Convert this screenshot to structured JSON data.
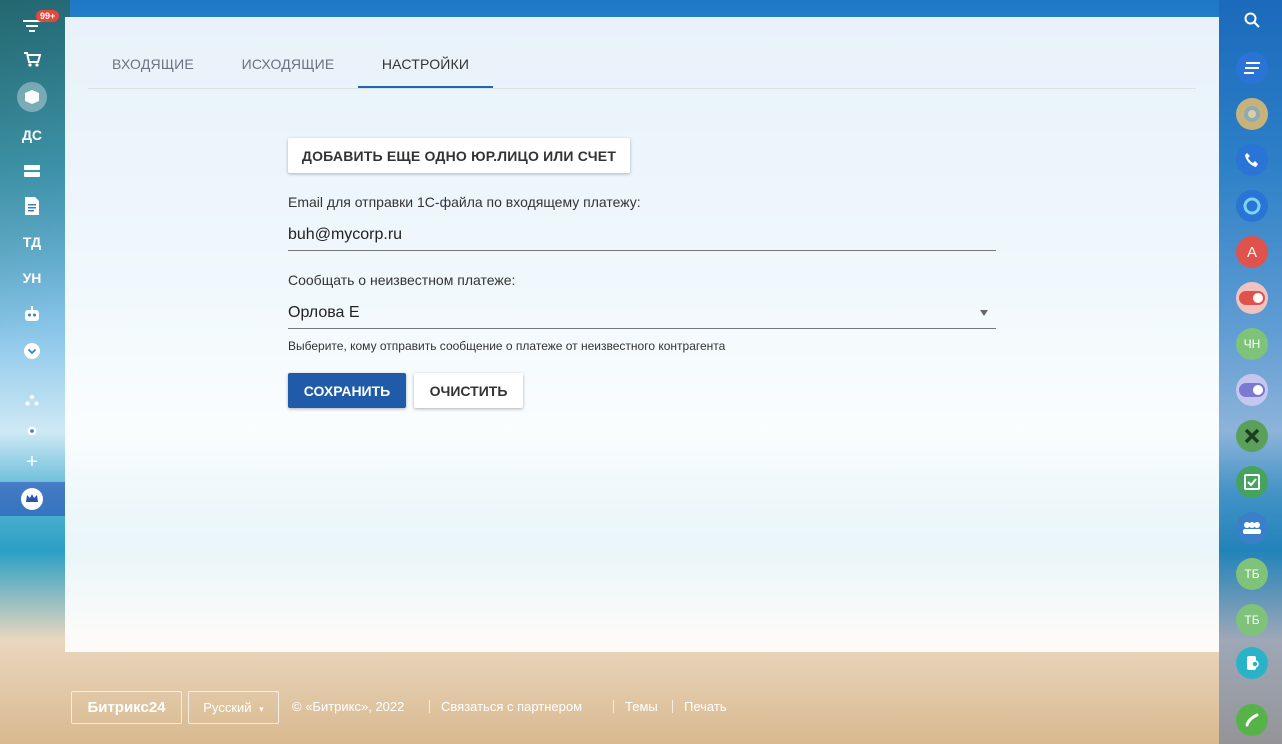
{
  "tabs": [
    {
      "label": "ВХОДЯЩИЕ"
    },
    {
      "label": "ИСХОДЯЩИЕ"
    },
    {
      "label": "НАСТРОЙКИ"
    }
  ],
  "form": {
    "add_button": "ДОБАВИТЬ ЕЩЕ ОДНО ЮР.ЛИЦО ИЛИ СЧЕТ",
    "email_label": "Email для отправки 1С-файла по входящему платежу:",
    "email_value": "buh@mycorp.ru",
    "notify_label": "Сообщать о неизвестном платеже:",
    "notify_value": "Орлова Е",
    "notify_hint": "Выберите, кому отправить сообщение о платеже от неизвестного контрагента",
    "save_button": "СОХРАНИТЬ",
    "clear_button": "ОЧИСТИТЬ"
  },
  "left_rail": {
    "badge": "99+",
    "items": [
      {
        "icon": "filter-icon"
      },
      {
        "icon": "cart-icon"
      },
      {
        "icon": "box-icon"
      },
      {
        "label": "ДС"
      },
      {
        "icon": "inbox-icon"
      },
      {
        "icon": "document-icon"
      },
      {
        "label": "ТД"
      },
      {
        "label": "УН"
      },
      {
        "icon": "robot-icon"
      },
      {
        "icon": "chevron-down-icon"
      },
      {
        "icon": "sitemap-icon"
      },
      {
        "icon": "gear-icon"
      },
      {
        "icon": "plus-icon"
      },
      {
        "icon": "crown-icon"
      }
    ]
  },
  "right_rail": {
    "items": [
      {
        "icon": "search-icon"
      },
      {
        "icon": "feed-icon",
        "color": "#2a74d6"
      },
      {
        "icon": "avatar-icon",
        "color": "#c7b27a"
      },
      {
        "icon": "phone-icon",
        "color": "#2a74d6"
      },
      {
        "icon": "circle-icon",
        "color": "#2a74d6"
      },
      {
        "icon": "letter-a-icon",
        "label": "А",
        "color": "#e0524c"
      },
      {
        "icon": "toggle-icon",
        "color": "#e0524c"
      },
      {
        "label": "ЧН",
        "color": "#7fc27a"
      },
      {
        "icon": "toggle-icon",
        "color": "#7a7bd0"
      },
      {
        "icon": "close-x-icon",
        "color": "#5aa05a"
      },
      {
        "icon": "checkbox-icon",
        "color": "#45a35e"
      },
      {
        "icon": "group-icon",
        "color": "#3a7fc8"
      },
      {
        "label": "ТБ",
        "color": "#7fc27a"
      },
      {
        "label": "ТБ",
        "color": "#7fc27a"
      },
      {
        "icon": "mobile-icon",
        "color": "#2ab3c8"
      },
      {
        "icon": "call-icon",
        "color": "#55b34a"
      }
    ]
  },
  "footer": {
    "logo": "Битрикс24",
    "language": "Русский",
    "copyright": "© «Битрикс», 2022",
    "partner_link": "Связаться с партнером",
    "themes_link": "Темы",
    "print_link": "Печать"
  }
}
